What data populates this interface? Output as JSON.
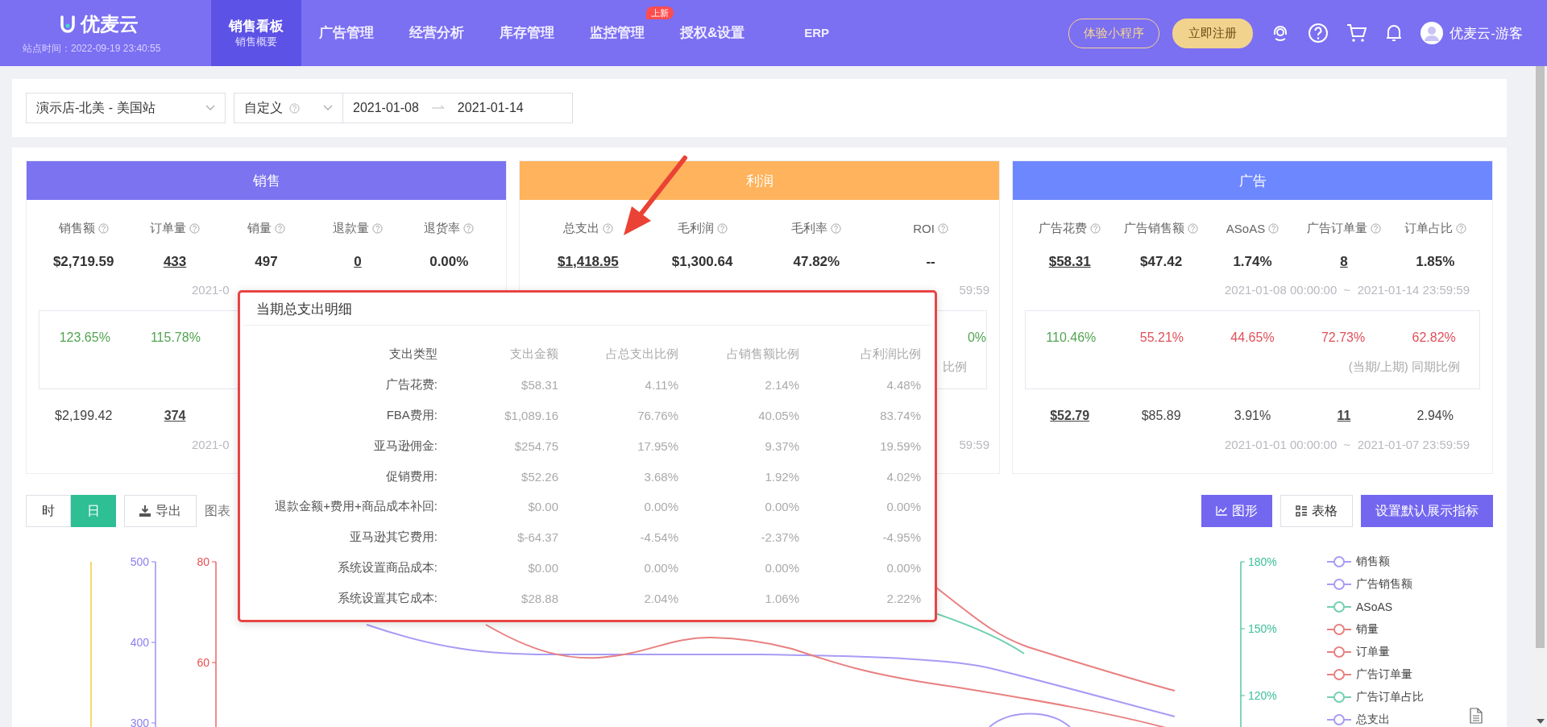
{
  "header": {
    "logo": "优麦云",
    "site_time": "站点时间：2022-09-19 23:40:55",
    "nav": [
      {
        "label": "销售看板",
        "sub": "销售概要",
        "selected": true
      },
      {
        "label": "广告管理",
        "selected": false
      },
      {
        "label": "经营分析",
        "selected": false
      },
      {
        "label": "库存管理",
        "selected": false
      },
      {
        "label": "监控管理",
        "badge": "上新",
        "selected": false
      },
      {
        "label": "授权&设置",
        "selected": false
      },
      {
        "label": "ERP",
        "selected": false
      }
    ],
    "mini_program_button": "体验小程序",
    "register_button": "立即注册",
    "user": "优麦云-游客"
  },
  "filters": {
    "store": "演示店-北美 - 美国站",
    "range_type": "自定义",
    "start_date": "2021-01-08",
    "end_date": "2021-01-14"
  },
  "cards": [
    {
      "title": "销售",
      "color": "#7b73f0",
      "labels": [
        "销售额",
        "订单量",
        "销量",
        "退款量",
        "退货率"
      ],
      "values": [
        {
          "text": "$2,719.59",
          "link": false
        },
        {
          "text": "433",
          "link": true
        },
        {
          "text": "497",
          "link": false
        },
        {
          "text": "0",
          "link": true
        },
        {
          "text": "0.00%",
          "link": false
        }
      ],
      "current_date": {
        "text": "2021-0",
        "kind": "head"
      },
      "ratios": [
        {
          "text": "123.65%",
          "color": "#52a552"
        },
        {
          "text": "115.78%",
          "color": "#52a552"
        }
      ],
      "previous": [
        {
          "text": "$2,199.42",
          "link": false
        },
        {
          "text": "374",
          "link": true
        }
      ],
      "previous_date": {
        "text": "2021-0",
        "kind": "head"
      }
    },
    {
      "title": "利润",
      "color": "#ffb35c",
      "labels": [
        "总支出",
        "毛利润",
        "毛利率",
        "ROI"
      ],
      "values": [
        {
          "text": "$1,418.95",
          "link": true
        },
        {
          "text": "$1,300.64",
          "link": false
        },
        {
          "text": "47.82%",
          "link": false
        },
        {
          "text": "--",
          "link": false
        }
      ],
      "current_date": {
        "text": "59:59",
        "kind": "tail"
      },
      "ratio_fragment": {
        "text": "0%",
        "color": "#52a552"
      },
      "ratio_note": "比例",
      "previous_date": {
        "text": "59:59",
        "kind": "tail"
      }
    },
    {
      "title": "广告",
      "color": "#6d87ff",
      "labels": [
        "广告花费",
        "广告销售额",
        "ASoAS",
        "广告订单量",
        "订单占比"
      ],
      "values": [
        {
          "text": "$58.31",
          "link": true
        },
        {
          "text": "$47.42",
          "link": false
        },
        {
          "text": "1.74%",
          "link": false
        },
        {
          "text": "8",
          "link": true
        },
        {
          "text": "1.85%",
          "link": false
        }
      ],
      "current_date": {
        "text": "2021-01-08 00:00:00  ~  2021-01-14 23:59:59",
        "kind": "whole"
      },
      "ratios": [
        {
          "text": "110.46%",
          "color": "#52a552"
        },
        {
          "text": "55.21%",
          "color": "#e0505a"
        },
        {
          "text": "44.65%",
          "color": "#e0505a"
        },
        {
          "text": "72.73%",
          "color": "#e0505a"
        },
        {
          "text": "62.82%",
          "color": "#e0505a"
        }
      ],
      "ratio_note": "(当期/上期) 同期比例",
      "previous": [
        {
          "text": "$52.79",
          "link": true
        },
        {
          "text": "$85.89",
          "link": false
        },
        {
          "text": "3.91%",
          "link": false
        },
        {
          "text": "11",
          "link": true
        },
        {
          "text": "2.94%",
          "link": false
        }
      ],
      "previous_date": {
        "text": "2021-01-01 00:00:00  ~  2021-01-07 23:59:59",
        "kind": "whole"
      }
    }
  ],
  "toolbar": {
    "granularity": [
      {
        "label": "时",
        "selected": false
      },
      {
        "label": "日",
        "selected": true
      }
    ],
    "export_button": "导出",
    "chart_label": "图表",
    "chart_button": "图形",
    "table_button": "表格",
    "default_metrics_button": "设置默认展示指标"
  },
  "chart": {
    "left_axes": [
      {
        "ticks": [
          "500",
          "400",
          "300"
        ],
        "color": "#8a7ff0"
      },
      {
        "ticks": [
          "80",
          "60"
        ],
        "color": "#e85050"
      }
    ],
    "right_axis": {
      "ticks": [
        "180%",
        "150%",
        "120%"
      ],
      "color": "#3cbf9a"
    },
    "legend": [
      {
        "label": "销售额",
        "color": "#a79cf5"
      },
      {
        "label": "广告销售额",
        "color": "#a79cf5"
      },
      {
        "label": "ASoAS",
        "color": "#72d0b0"
      },
      {
        "label": "销量",
        "color": "#e98080"
      },
      {
        "label": "订单量",
        "color": "#e98080"
      },
      {
        "label": "广告订单量",
        "color": "#e98080"
      },
      {
        "label": "广告订单占比",
        "color": "#72d0b0"
      },
      {
        "label": "总支出",
        "color": "#a79cf5"
      }
    ]
  },
  "popup": {
    "title": "当期总支出明细",
    "columns": [
      "支出类型",
      "支出金额",
      "占总支出比例",
      "占销售额比例",
      "占利润比例"
    ],
    "rows": [
      [
        "广告花费:",
        "$58.31",
        "4.11%",
        "2.14%",
        "4.48%"
      ],
      [
        "FBA费用:",
        "$1,089.16",
        "76.76%",
        "40.05%",
        "83.74%"
      ],
      [
        "亚马逊佣金:",
        "$254.75",
        "17.95%",
        "9.37%",
        "19.59%"
      ],
      [
        "促销费用:",
        "$52.26",
        "3.68%",
        "1.92%",
        "4.02%"
      ],
      [
        "退款金额+费用+商品成本补回:",
        "$0.00",
        "0.00%",
        "0.00%",
        "0.00%"
      ],
      [
        "亚马逊其它费用:",
        "$-64.37",
        "-4.54%",
        "-2.37%",
        "-4.95%"
      ],
      [
        "系统设置商品成本:",
        "$0.00",
        "0.00%",
        "0.00%",
        "0.00%"
      ],
      [
        "系统设置其它成本:",
        "$28.88",
        "2.04%",
        "1.06%",
        "2.22%"
      ]
    ]
  }
}
